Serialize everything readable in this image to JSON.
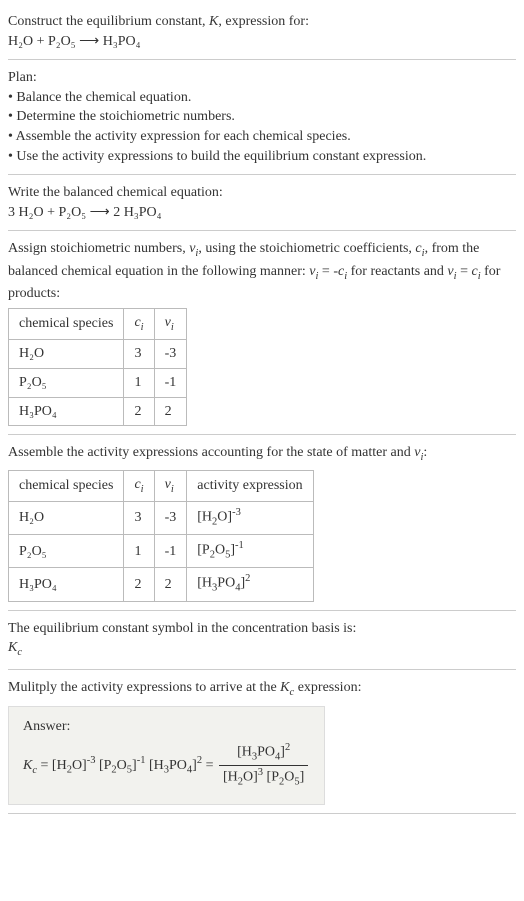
{
  "intro": {
    "line1": "Construct the equilibrium constant, K, expression for:",
    "equation": "H₂O + P₂O₅ ⟶ H₃PO₄"
  },
  "plan": {
    "header": "Plan:",
    "b1": "• Balance the chemical equation.",
    "b2": "• Determine the stoichiometric numbers.",
    "b3": "• Assemble the activity expression for each chemical species.",
    "b4": "• Use the activity expressions to build the equilibrium constant expression."
  },
  "balanced": {
    "header": "Write the balanced chemical equation:",
    "equation": "3 H₂O + P₂O₅ ⟶ 2 H₃PO₄"
  },
  "stoich": {
    "text": "Assign stoichiometric numbers, νᵢ, using the stoichiometric coefficients, cᵢ, from the balanced chemical equation in the following manner: νᵢ = -cᵢ for reactants and νᵢ = cᵢ for products:",
    "h1": "chemical species",
    "h2": "cᵢ",
    "h3": "νᵢ",
    "r1c1": "H₂O",
    "r1c2": "3",
    "r1c3": "-3",
    "r2c1": "P₂O₅",
    "r2c2": "1",
    "r2c3": "-1",
    "r3c1": "H₃PO₄",
    "r3c2": "2",
    "r3c3": "2"
  },
  "activity": {
    "text": "Assemble the activity expressions accounting for the state of matter and νᵢ:",
    "h1": "chemical species",
    "h2": "cᵢ",
    "h3": "νᵢ",
    "h4": "activity expression",
    "r1c1": "H₂O",
    "r1c2": "3",
    "r1c3": "-3",
    "r1c4": "[H₂O]⁻³",
    "r2c1": "P₂O₅",
    "r2c2": "1",
    "r2c3": "-1",
    "r2c4": "[P₂O₅]⁻¹",
    "r3c1": "H₃PO₄",
    "r3c2": "2",
    "r3c3": "2",
    "r3c4": "[H₃PO₄]²"
  },
  "symbol": {
    "text": "The equilibrium constant symbol in the concentration basis is:",
    "sym": "K꜀"
  },
  "multiply": {
    "text": "Mulitply the activity expressions to arrive at the K꜀ expression:"
  },
  "answer": {
    "label": "Answer:",
    "lhs": "K꜀ = [H₂O]⁻³ [P₂O₅]⁻¹ [H₃PO₄]² = ",
    "num": "[H₃PO₄]²",
    "den": "[H₂O]³ [P₂O₅]"
  }
}
